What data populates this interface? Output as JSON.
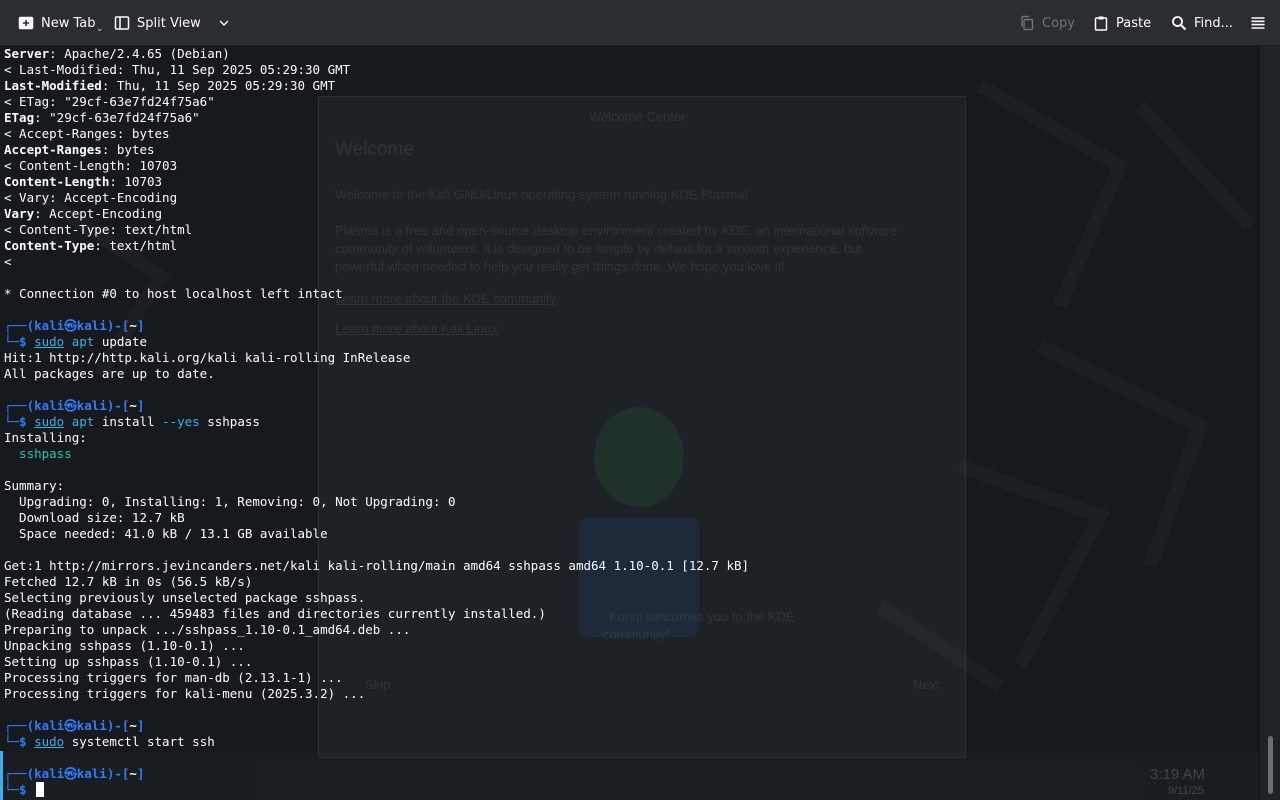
{
  "toolbar": {
    "new_tab": "New Tab",
    "split_view": "Split View",
    "copy": "Copy",
    "paste": "Paste",
    "find": "Find..."
  },
  "colors": {
    "toolbar_bg": "#2a2e32",
    "terminal_bg": "#16191d",
    "prompt_blue": "#2f7df6",
    "accent_cyan": "#3daee9",
    "package_green": "#27c8a4"
  },
  "terminal": {
    "l01": {
      "key": "Server",
      "val": ": Apache/2.4.65 (Debian)"
    },
    "l02": "< Last-Modified: Thu, 11 Sep 2025 05:29:30 GMT",
    "l03": {
      "key": "Last-Modified",
      "val": ": Thu, 11 Sep 2025 05:29:30 GMT"
    },
    "l04": "< ETag: \"29cf-63e7fd24f75a6\"",
    "l05": {
      "key": "ETag",
      "val": ": \"29cf-63e7fd24f75a6\""
    },
    "l06": "< Accept-Ranges: bytes",
    "l07": {
      "key": "Accept-Ranges",
      "val": ": bytes"
    },
    "l08": "< Content-Length: 10703",
    "l09": {
      "key": "Content-Length",
      "val": ": 10703"
    },
    "l10": "< Vary: Accept-Encoding",
    "l11": {
      "key": "Vary",
      "val": ": Accept-Encoding"
    },
    "l12": "< Content-Type: text/html",
    "l13": {
      "key": "Content-Type",
      "val": ": text/html"
    },
    "l14": "<",
    "l15": "",
    "l16": "* Connection #0 to host localhost left intact",
    "l17": "",
    "p1": {
      "user": "kali",
      "sep": "㉿",
      "host": "kali",
      "dir": "~",
      "cmd": "sudo",
      "arg1": "apt",
      "rest": " update"
    },
    "l20": "Hit:1 http://http.kali.org/kali kali-rolling InRelease",
    "l21": "All packages are up to date.",
    "l22": "",
    "p2": {
      "user": "kali",
      "sep": "㉿",
      "host": "kali",
      "dir": "~",
      "cmd": "sudo",
      "arg1": "apt",
      "rest": " install ",
      "flag": "--yes",
      "rest2": " sshpass"
    },
    "l25": "Installing:",
    "l26": "  sshpass",
    "l27": "",
    "l28": "Summary:",
    "l29": "  Upgrading: 0, Installing: 1, Removing: 0, Not Upgrading: 0",
    "l30": "  Download size: 12.7 kB",
    "l31": "  Space needed: 41.0 kB / 13.1 GB available",
    "l32": "",
    "l33": "Get:1 http://mirrors.jevincanders.net/kali kali-rolling/main amd64 sshpass amd64 1.10-0.1 [12.7 kB]",
    "l34": "Fetched 12.7 kB in 0s (56.5 kB/s)",
    "l35": "Selecting previously unselected package sshpass.",
    "l36": "(Reading database ... 459483 files and directories currently installed.)",
    "l37": "Preparing to unpack .../sshpass_1.10-0.1_amd64.deb ...",
    "l38": "Unpacking sshpass (1.10-0.1) ...",
    "l39": "Setting up sshpass (1.10-0.1) ...",
    "l40": "Processing triggers for man-db (2.13.1-1) ...",
    "l41": "Processing triggers for kali-menu (2025.3.2) ...",
    "l42": "",
    "p3": {
      "user": "kali",
      "sep": "㉿",
      "host": "kali",
      "dir": "~",
      "cmd": "sudo",
      "arg1": "systemctl",
      "rest": " start ssh"
    },
    "l45": "",
    "p4": {
      "user": "kali",
      "sep": "㉿",
      "host": "kali",
      "dir": "~"
    }
  },
  "background": {
    "welcome_title": "Welcome",
    "welcome_window_title": "Welcome Center",
    "welcome_line1": "Welcome to the Kali GNU/Linux operating system running KDE Plasma!",
    "welcome_line2": "Plasma is a free and open-source desktop environment created by KDE, an international software",
    "welcome_line3": "community of volunteers. It is designed to be simple by default for a smooth experience, but",
    "welcome_line4": "powerful when needed to help you really get things done. We hope you love it!",
    "link1": "Learn more about the KDE community",
    "link2": "Learn more about Kali Linux",
    "mascot_caption1": "Konqi welcomes you to the KDE",
    "mascot_caption2": "community!",
    "skip": "Skip",
    "next": "Next",
    "clock_time": "3:19 AM",
    "clock_date": "9/11/25"
  }
}
